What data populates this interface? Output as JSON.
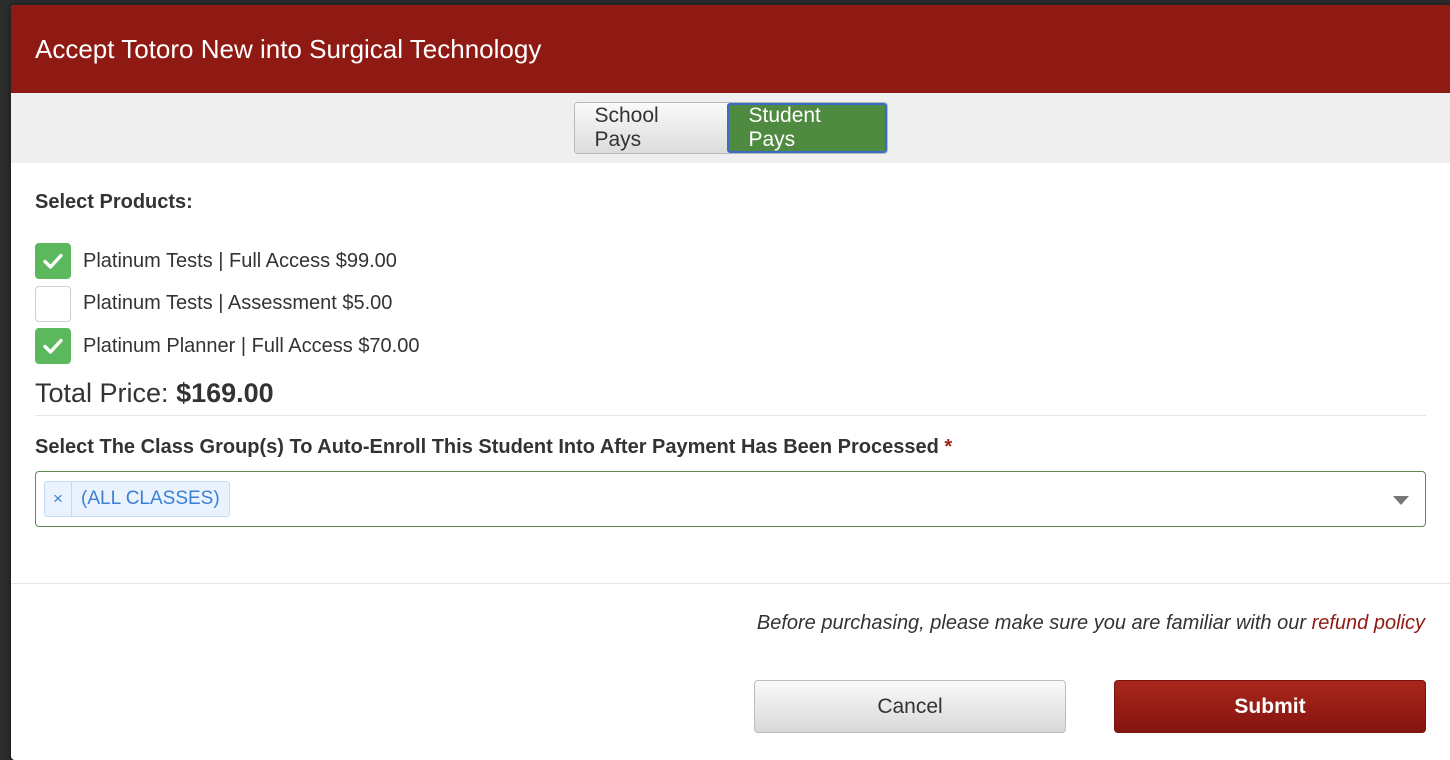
{
  "modal": {
    "title": "Accept Totoro New into Surgical Technology"
  },
  "payment_toggle": {
    "options": [
      {
        "label": "School Pays",
        "active": false
      },
      {
        "label": "Student Pays",
        "active": true
      }
    ]
  },
  "products": {
    "heading": "Select Products:",
    "items": [
      {
        "label": "Platinum Tests | Full Access $99.00",
        "checked": true
      },
      {
        "label": "Platinum Tests | Assessment $5.00",
        "checked": false
      },
      {
        "label": "Platinum Planner | Full Access $70.00",
        "checked": true
      }
    ],
    "total_label": "Total Price:",
    "total_value": "$169.00"
  },
  "class_groups": {
    "label": "Select The Class Group(s) To Auto-Enroll This Student Into After Payment Has Been Processed",
    "required_mark": "*",
    "selected": [
      {
        "remove_symbol": "×",
        "text": "(ALL CLASSES)"
      }
    ]
  },
  "footer": {
    "refund_note": "Before purchasing, please make sure you are familiar with our",
    "refund_link": "refund policy",
    "cancel_label": "Cancel",
    "submit_label": "Submit"
  },
  "colors": {
    "header_bg": "#8f1a13",
    "active_toggle": "#4e8a3f",
    "checkbox_checked": "#5cb85c",
    "tag_text": "#3a80d6"
  }
}
